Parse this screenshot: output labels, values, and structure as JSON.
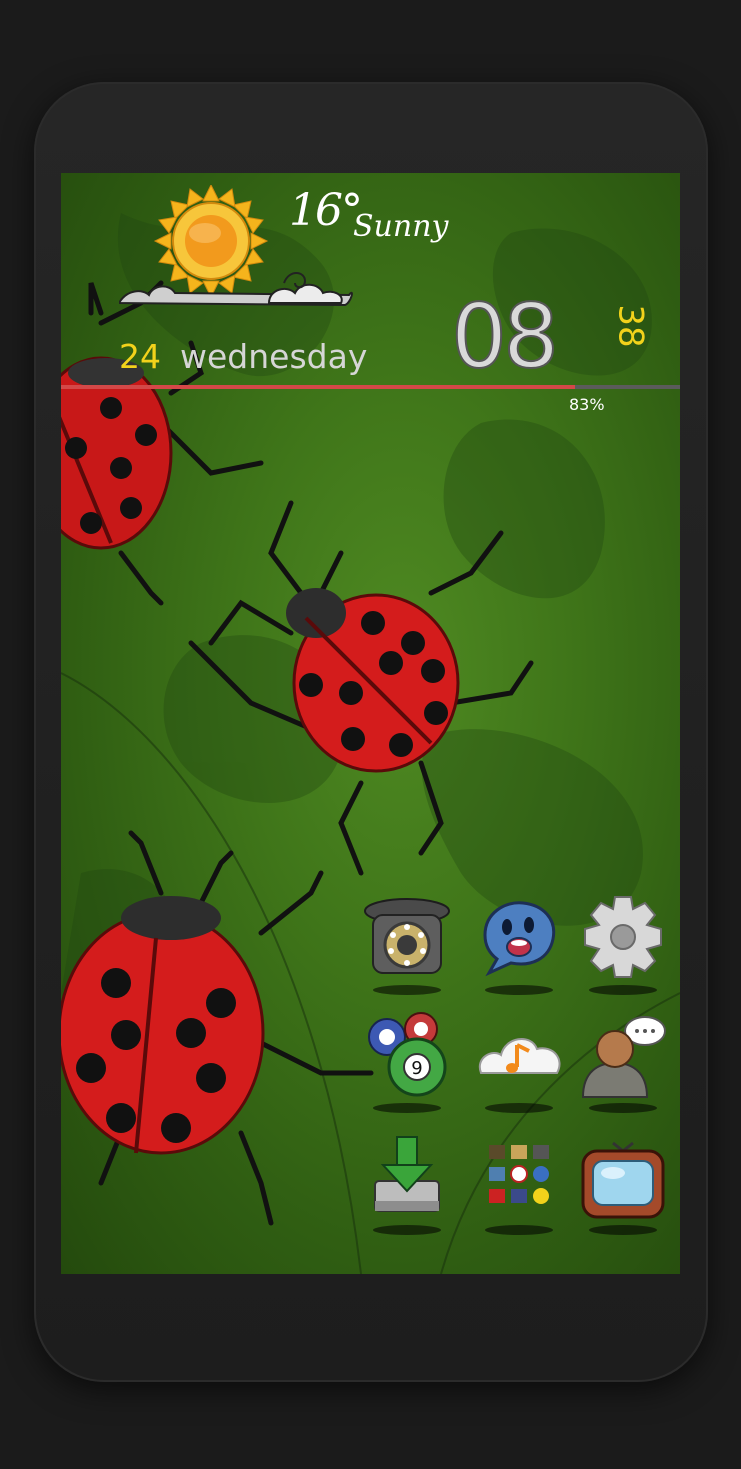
{
  "weather": {
    "temperature": "16°",
    "condition": "Sunny",
    "icon": "sun-cloud-icon"
  },
  "date": {
    "day": "24",
    "weekday": "wednesday"
  },
  "clock": {
    "hour": "08",
    "minute": "38"
  },
  "battery": {
    "label": "83%",
    "level": 0.83
  },
  "colors": {
    "accent_yellow": "#f2d21b",
    "battery_fill": "#d44848",
    "wallpaper_green": "#3f7519"
  },
  "home_icons": [
    {
      "name": "phone-icon"
    },
    {
      "name": "messaging-icon"
    },
    {
      "name": "settings-icon"
    },
    {
      "name": "games-icon"
    },
    {
      "name": "music-icon"
    },
    {
      "name": "contacts-icon"
    },
    {
      "name": "download-icon"
    },
    {
      "name": "app-drawer-icon"
    },
    {
      "name": "tv-icon"
    }
  ]
}
